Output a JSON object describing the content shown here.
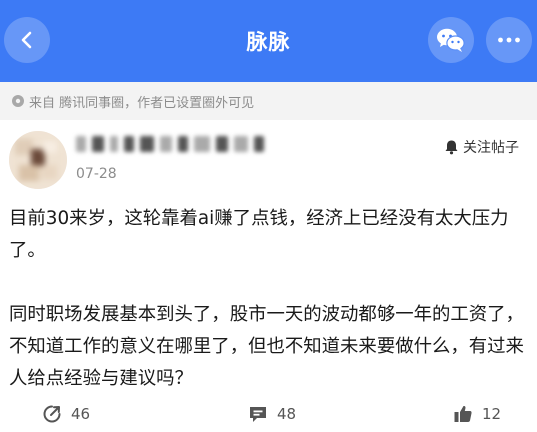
{
  "header": {
    "title": "脉脉",
    "back_icon": "chevron-left-icon",
    "share_icon": "wechat-icon",
    "more_icon": "more-dots-icon",
    "color": "#3d7af5"
  },
  "source": {
    "text": "来自 腾讯同事圈，作者已设置圈外可见",
    "icon": "eye-icon"
  },
  "author": {
    "date": "07-28"
  },
  "follow": {
    "label": "关注帖子",
    "icon": "bell-icon"
  },
  "post": {
    "paragraphs": [
      "目前30来岁，这轮靠着ai赚了点钱，经济上已经没有太大压力了。",
      "同时职场发展基本到头了，股市一天的波动都够一年的工资了，不知道工作的意义在哪里了，但也不知道未来要做什么，有过来人给点经验与建议吗？"
    ]
  },
  "actions": {
    "share_count": "46",
    "comment_count": "48",
    "like_count": "12"
  }
}
